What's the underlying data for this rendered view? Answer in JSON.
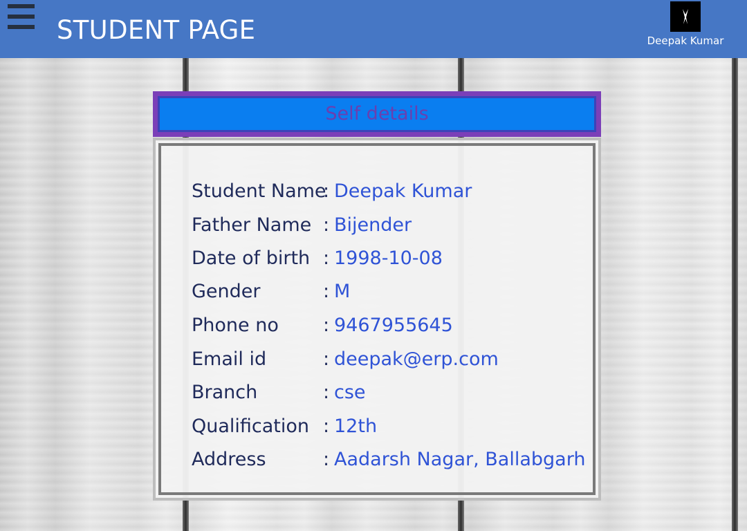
{
  "header": {
    "menu_icon": "hamburger-menu-icon",
    "title": "STUDENT PAGE",
    "user_name": "Deepak Kumar",
    "avatar_icon": "user-avatar-icon"
  },
  "colors": {
    "header_bg": "#4677c5",
    "panel_header_bg": "#0a7ef0",
    "panel_header_border": "#7b3fb8",
    "label_text": "#1f2a5a",
    "value_text": "#2f53d6"
  },
  "panel": {
    "title": "Self details",
    "fields": [
      {
        "label": "Student Name",
        "value": "Deepak Kumar"
      },
      {
        "label": "Father Name",
        "value": "Bijender"
      },
      {
        "label": "Date of birth",
        "value": "1998-10-08"
      },
      {
        "label": "Gender",
        "value": "M"
      },
      {
        "label": "Phone no",
        "value": "9467955645"
      },
      {
        "label": "Email id",
        "value": "deepak@erp.com"
      },
      {
        "label": "Branch",
        "value": "cse"
      },
      {
        "label": "Qualification",
        "value": "12th"
      },
      {
        "label": "Address",
        "value": "Aadarsh Nagar, Ballabgarh"
      }
    ]
  }
}
